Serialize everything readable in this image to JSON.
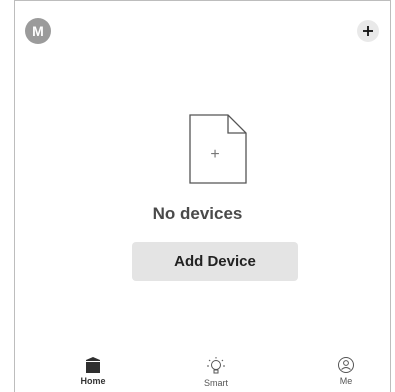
{
  "header": {
    "avatar_initial": "M",
    "add_label": "+"
  },
  "empty_state": {
    "plus_glyph": "+",
    "title": "No devices",
    "add_device_label": "Add Device"
  },
  "tabbar": {
    "items": [
      {
        "label": "Home",
        "icon": "home-icon",
        "active": true
      },
      {
        "label": "Smart",
        "icon": "bulb-icon",
        "active": false
      },
      {
        "label": "Me",
        "icon": "profile-icon",
        "active": false
      }
    ]
  },
  "colors": {
    "avatar_bg": "#9b9b9b",
    "button_bg": "#e4e4e4",
    "text_dark": "#4a4a4a"
  }
}
